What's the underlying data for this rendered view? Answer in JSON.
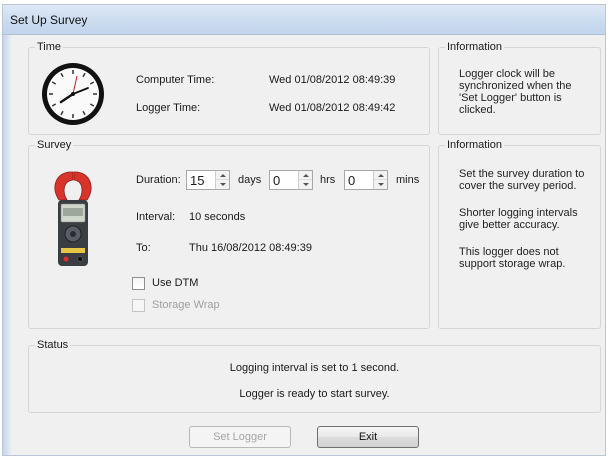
{
  "window": {
    "title": "Set Up Survey"
  },
  "time_group": {
    "legend": "Time",
    "computer_time_label": "Computer Time:",
    "computer_time_value": "Wed 01/08/2012 08:49:39",
    "logger_time_label": "Logger Time:",
    "logger_time_value": "Wed 01/08/2012 08:49:42"
  },
  "time_info": {
    "legend": "Information",
    "line1": "Logger clock will be",
    "line2": "synchronized when the",
    "line3": "'Set Logger' button is",
    "line4": "clicked."
  },
  "survey_group": {
    "legend": "Survey",
    "duration_label": "Duration:",
    "days_value": "15",
    "days_label": "days",
    "hrs_value": "0",
    "hrs_label": "hrs",
    "mins_value": "0",
    "mins_label": "mins",
    "interval_label": "Interval:",
    "interval_value": "10 seconds",
    "to_label": "To:",
    "to_value": "Thu 16/08/2012 08:49:39",
    "use_dtm_label": "Use DTM",
    "use_dtm_checked": false,
    "storage_wrap_label": "Storage Wrap",
    "storage_wrap_enabled": false
  },
  "survey_info": {
    "legend": "Information",
    "p1_line1": "Set the survey duration to",
    "p1_line2": "cover the survey period.",
    "p2_line1": "Shorter logging intervals",
    "p2_line2": "give better accuracy.",
    "p3_line1": "This logger does not",
    "p3_line2": "support storage wrap."
  },
  "status_group": {
    "legend": "Status",
    "line1": "Logging interval is set to 1  second.",
    "line2": "Logger is ready to start survey."
  },
  "buttons": {
    "set_logger_label": "Set Logger",
    "set_logger_enabled": false,
    "exit_label": "Exit"
  },
  "icons": {
    "clock": "clock-icon",
    "clamp_meter": "clamp-meter-icon"
  },
  "colors": {
    "window_bg": "#f0f0f0",
    "titlebar": "#cbdcef",
    "clamp_red": "#d8342c"
  }
}
